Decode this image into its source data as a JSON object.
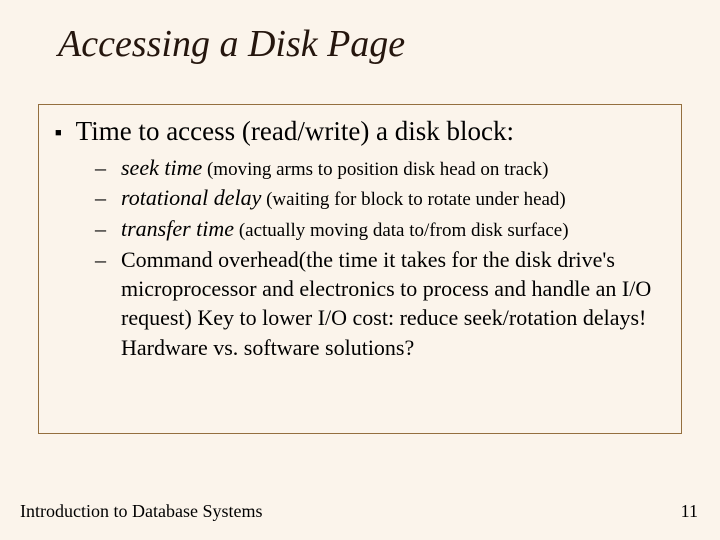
{
  "title": "Accessing a Disk Page",
  "main_bullet": "Time to access (read/write) a disk block:",
  "sub": [
    {
      "term": "seek time",
      "desc": " (moving arms to position disk head on track)"
    },
    {
      "term": "rotational delay",
      "desc": " (waiting for block to rotate under head)"
    },
    {
      "term": "transfer time",
      "desc": " (actually moving data to/from disk surface)"
    }
  ],
  "sub_marker": "–",
  "final_sub": "Command overhead(the time it takes for the disk drive's microprocessor and electronics to process and handle an I/O request) Key to lower I/O cost: reduce seek/rotation delays!  Hardware vs. software solutions?",
  "footer_left": "Introduction to Database Systems",
  "footer_right": "11"
}
